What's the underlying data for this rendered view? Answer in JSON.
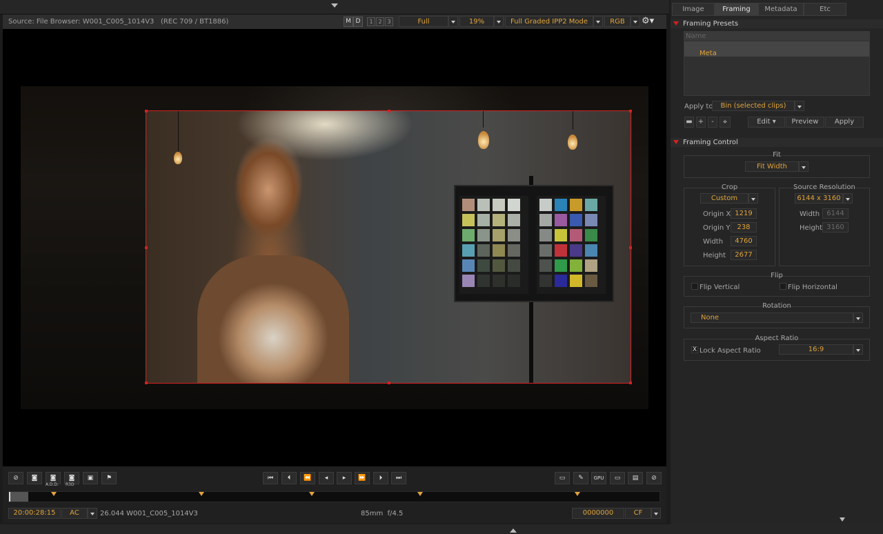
{
  "viewer": {
    "source": "Source: File Browser: W001_C005_1014V3",
    "color_space": "(REC 709 / BT1886)",
    "m_label": "M",
    "d_label": "D",
    "n1": "1",
    "n2": "2",
    "n3": "3",
    "quality": "Full",
    "zoom": "19%",
    "mode": "Full Graded IPP2 Mode",
    "channel": "RGB"
  },
  "transport": {
    "timecode": "20:00:28:15",
    "tc_mode": "AC",
    "clip_info": "26.044 W001_C005_1014V3",
    "lens": "85mm  f/4.5",
    "frame": "0000000",
    "frame_mode": "CF",
    "add_label": "A.D.D.",
    "rsd_label": "R3D",
    "gpu_label": "GPU"
  },
  "tabs": [
    "Image",
    "Framing",
    "Metadata",
    "Etc"
  ],
  "framing_presets": {
    "title": "Framing Presets",
    "name_placeholder": "Name",
    "item": "Meta",
    "apply_to_label": "Apply to:",
    "apply_to_value": "Bin (selected clips)",
    "add_label": "+",
    "minus_label": "-",
    "edit": "Edit",
    "preview": "Preview",
    "apply": "Apply"
  },
  "framing_control": {
    "title": "Framing Control",
    "fit_label": "Fit",
    "fit_value": "Fit Width",
    "crop_label": "Crop",
    "crop_value": "Custom",
    "origin_x_label": "Origin X",
    "origin_x": "1219",
    "origin_y_label": "Origin Y",
    "origin_y": "238",
    "width_label": "Width",
    "width": "4760",
    "height_label": "Height",
    "height": "2677",
    "source_res_label": "Source Resolution",
    "source_res_value": "6144 x 3160",
    "src_width_label": "Width",
    "src_width": "6144",
    "src_height_label": "Height",
    "src_height": "3160",
    "flip_label": "Flip",
    "flip_vertical": "Flip Vertical",
    "flip_horizontal": "Flip Horizontal",
    "rotation_label": "Rotation",
    "rotation_value": "None",
    "aspect_label": "Aspect Ratio",
    "lock_mark": "X",
    "lock_aspect": "Lock Aspect Ratio",
    "aspect_value": "16:9"
  },
  "colors": {
    "accent": "#e1a43b",
    "frame": "#d62020"
  }
}
